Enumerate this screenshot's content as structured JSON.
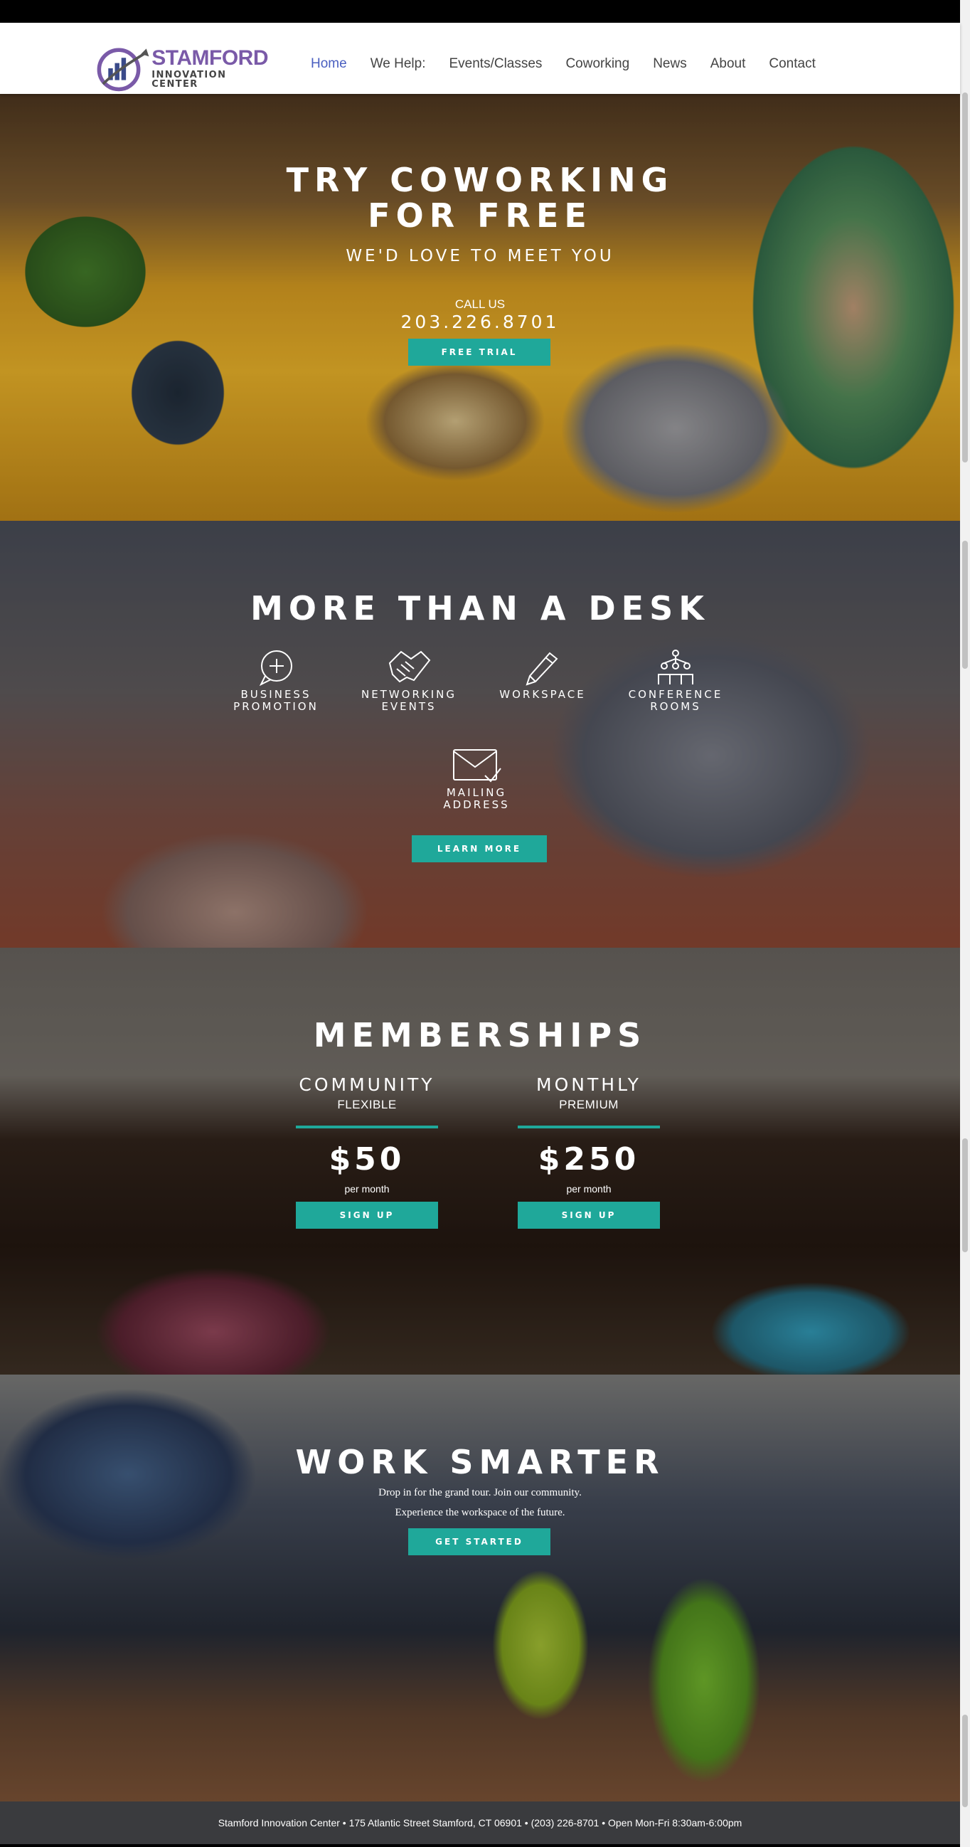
{
  "header": {
    "logo": {
      "line1": "STAMFORD",
      "line2": "INNOVATION CENTER",
      "brand_color": "#7a5aa8"
    },
    "nav": [
      {
        "label": "Home",
        "active": true
      },
      {
        "label": "We Help:",
        "active": false
      },
      {
        "label": "Events/Classes",
        "active": false
      },
      {
        "label": "Coworking",
        "active": false
      },
      {
        "label": "News",
        "active": false
      },
      {
        "label": "About",
        "active": false
      },
      {
        "label": "Contact",
        "active": false
      }
    ],
    "active_color": "#4a5fc0"
  },
  "hero": {
    "title_line1": "TRY COWORKING",
    "title_line2": "FOR FREE",
    "subtitle": "WE'D LOVE TO MEET YOU",
    "call_label": "CALL US",
    "phone": "203.226.8701",
    "button": "FREE TRIAL"
  },
  "desk": {
    "title": "MORE THAN A DESK",
    "features": [
      {
        "icon": "plus-chat-icon",
        "line1": "BUSINESS",
        "line2": "PROMOTION"
      },
      {
        "icon": "handshake-icon",
        "line1": "NETWORKING",
        "line2": "EVENTS"
      },
      {
        "icon": "pen-icon",
        "line1": "",
        "line2": "WORKSPACE"
      },
      {
        "icon": "people-network-icon",
        "line1": "CONFERENCE",
        "line2": "ROOMS"
      },
      {
        "icon": "envelope-check-icon",
        "line1": "MAILING",
        "line2": "ADDRESS"
      }
    ],
    "button": "LEARN MORE"
  },
  "memberships": {
    "title": "MEMBERSHIPS",
    "plans": [
      {
        "name": "COMMUNITY",
        "sub": "FLEXIBLE",
        "price": "$50",
        "per": "per month",
        "button": "SIGN UP"
      },
      {
        "name": "MONTHLY",
        "sub": "PREMIUM",
        "price": "$250",
        "per": "per month",
        "button": "SIGN UP"
      }
    ]
  },
  "smarter": {
    "title": "WORK SMARTER",
    "line1": "Drop in for the grand tour. Join our community.",
    "line2": "Experience the workspace of the future.",
    "button": "GET STARTED"
  },
  "footer": {
    "text": "Stamford Innovation Center • 175 Atlantic Street Stamford, CT 06901 • (203) 226-8701 • Open Mon-Fri 8:30am-6:00pm"
  },
  "colors": {
    "accent": "#1fa89a",
    "footer_bg": "#3a3b3e"
  }
}
